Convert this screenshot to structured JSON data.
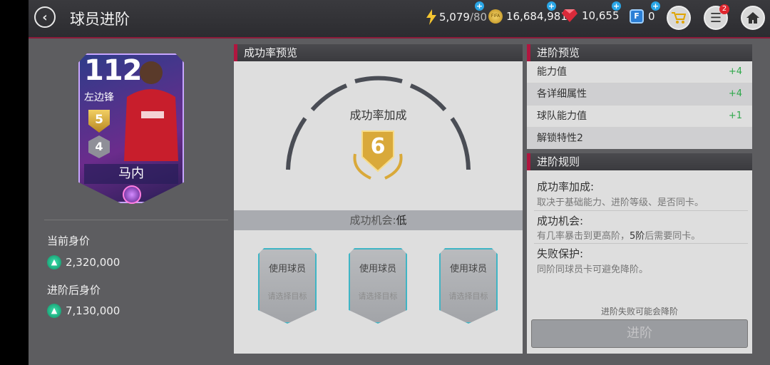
{
  "header": {
    "title": "球员进阶",
    "energy": "5,079",
    "energy_max": "/80",
    "coins": "16,684,981",
    "coin_icon_text": "FIFA",
    "gems": "10,655",
    "fifa_points": "0",
    "fifa_points_icon_text": "F",
    "notif_count": "2"
  },
  "player": {
    "rating": "112",
    "position": "左边锋",
    "rank_gold": "5",
    "rank_silver": "4",
    "name": "马内",
    "current_value_label": "当前身价",
    "current_value": "2,320,000",
    "after_value_label": "进阶后身价",
    "after_value": "7,130,000"
  },
  "success": {
    "title": "成功率预览",
    "bonus_label": "成功率加成",
    "bonus_value": "6",
    "chance_label": "成功机会:",
    "chance_value": "低",
    "slots": [
      {
        "title": "使用球员",
        "hint": "请选择目标"
      },
      {
        "title": "使用球员",
        "hint": "请选择目标"
      },
      {
        "title": "使用球员",
        "hint": "请选择目标"
      }
    ]
  },
  "preview": {
    "title": "进阶预览",
    "rows": [
      {
        "label": "能力值",
        "value": "+4"
      },
      {
        "label": "各详细属性",
        "value": "+4"
      },
      {
        "label": "球队能力值",
        "value": "+1"
      },
      {
        "label": "解锁特性2",
        "value": ""
      }
    ]
  },
  "rules": {
    "title": "进阶规则",
    "items": [
      {
        "title": "成功率加成:",
        "text": "取决于基础能力、进阶等级、是否同卡。"
      },
      {
        "title": "成功机会:",
        "text_a": "有几率暴击到更高阶，",
        "text_b": "5阶",
        "text_c": "后需要同卡。"
      },
      {
        "title": "失败保护:",
        "text": "同阶同球员卡可避免降阶。"
      }
    ],
    "warning": "进阶失败可能会降阶",
    "button": "进阶"
  },
  "colors": {
    "accent": "#b0163f",
    "positive": "#2ea84a",
    "slot_border": "#3fb5c5",
    "gold": "#d9a93a"
  }
}
